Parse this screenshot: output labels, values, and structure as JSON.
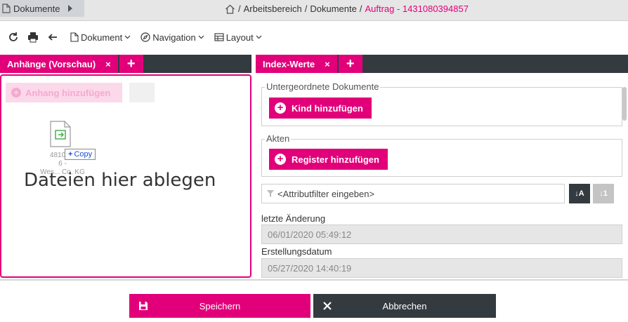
{
  "topbar": {
    "doc_tab_label": "Dokumente",
    "breadcrumb": {
      "sep1": "/",
      "workspace": "Arbeitsbereich",
      "sep2": "/",
      "documents": "Dokumente",
      "sep3": "/",
      "current": "Auftrag - 1431080394857"
    }
  },
  "toolbar": {
    "document_menu": "Dokument",
    "navigation_menu": "Navigation",
    "layout_menu": "Layout"
  },
  "left_panel": {
    "tab_label": "Anhänge (Vorschau)",
    "close_glyph": "×",
    "add_glyph": "+",
    "attach_button": "Anhang hinzufügen",
    "file_name_line1": "48108...",
    "file_name_line2": "6 -",
    "file_name_line3": "Wes... Co. KG",
    "copy_badge": "Copy",
    "drop_text": "Dateien hier ablegen"
  },
  "right_panel": {
    "tab_label": "Index-Werte",
    "close_glyph": "×",
    "add_glyph": "+",
    "child_docs_legend": "Untergeordnete Dokumente",
    "add_child_button": "Kind hinzufügen",
    "files_legend": "Akten",
    "add_register_button": "Register hinzufügen",
    "filter_placeholder": "<Attributfilter eingeben>",
    "last_change_label": "letzte Änderung",
    "last_change_value": "06/01/2020 05:49:12",
    "created_label": "Erstellungsdatum",
    "created_value": "05/27/2020 14:40:19"
  },
  "footer": {
    "save_label": "Speichern",
    "cancel_label": "Abbrechen"
  },
  "colors": {
    "accent": "#e2007a",
    "dark": "#333a40"
  }
}
